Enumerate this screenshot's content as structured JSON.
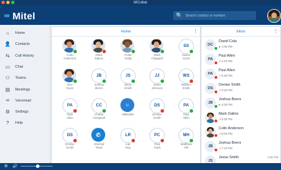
{
  "window": {
    "title": "MiCollab"
  },
  "colors": {
    "header": "#0b3f75",
    "accent": "#1b78c8",
    "present": "#27a844",
    "busy": "#d93b30",
    "away": "#f0a500"
  },
  "header": {
    "logo_text": "Mitel",
    "search": {
      "placeholder": "Search contact or number",
      "icon": "search-icon"
    }
  },
  "sidebar": {
    "items": [
      {
        "label": "Home",
        "icon": "home-icon",
        "glyph": "⌂"
      },
      {
        "label": "Contacts",
        "icon": "contacts-icon",
        "glyph": "👤"
      },
      {
        "label": "Call History",
        "icon": "call-history-icon",
        "glyph": "⇆"
      },
      {
        "label": "Chat",
        "icon": "chat-icon",
        "glyph": "▭"
      },
      {
        "label": "Teams",
        "icon": "teams-icon",
        "glyph": "⚇"
      },
      {
        "label": "Meetings",
        "icon": "meetings-icon",
        "glyph": "▤"
      },
      {
        "label": "Voicemail",
        "icon": "voicemail-icon",
        "glyph": "∞"
      },
      {
        "label": "Settings",
        "icon": "settings-icon",
        "glyph": "⚙"
      },
      {
        "label": "Help",
        "icon": "help-icon",
        "glyph": "?"
      }
    ]
  },
  "home": {
    "title": "Home",
    "more_icon": "more-icon",
    "tiles": [
      {
        "label": "Colin\nAnderson",
        "initials": "",
        "photo": true,
        "status": "present"
      },
      {
        "label": "Mark\nDalton",
        "initials": "",
        "photo": true,
        "status": "busy"
      },
      {
        "label": "Annie\nGatla",
        "initials": "",
        "photo": true,
        "status": "present"
      },
      {
        "label": "Mark\nChappell",
        "initials": "",
        "photo": true,
        "status": "present"
      },
      {
        "label": "Susan\nScott",
        "initials": "SS",
        "photo": false,
        "status": "present"
      },
      {
        "label": "Dev\nIssan",
        "initials": "",
        "photo": true,
        "status": "present"
      },
      {
        "label": "Joshua\nBeers",
        "initials": "JB",
        "photo": false,
        "status": "present"
      },
      {
        "label": "Steve\nSmith",
        "initials": "JS",
        "photo": false,
        "status": "present"
      },
      {
        "label": "Jesse\nJohnson",
        "initials": "JJ",
        "photo": false,
        "status": "present"
      },
      {
        "label": "William\nSmith",
        "initials": "WS",
        "photo": false,
        "status": "busy"
      },
      {
        "label": "Paul\nAllen",
        "initials": "PA",
        "photo": false,
        "status": "busy"
      },
      {
        "label": "Charlie\nCampbell",
        "initials": "CC",
        "photo": false,
        "status": "present"
      },
      {
        "label": "MiMobile",
        "initials": "☺",
        "photo": false,
        "status": "",
        "special": "group"
      },
      {
        "label": "Denise\nSmith",
        "initials": "DS",
        "photo": false,
        "status": "busy"
      },
      {
        "label": "Paul\nAllen",
        "initials": "PA",
        "photo": false,
        "status": "present"
      },
      {
        "label": "Denise\nSmith",
        "initials": "DS",
        "photo": false,
        "status": "busy"
      },
      {
        "label": "Internal\nTeam",
        "initials": "✆",
        "photo": false,
        "status": "",
        "special": "phone"
      },
      {
        "label": "Lue\nRay",
        "initials": "LR",
        "photo": false,
        "status": "busy"
      },
      {
        "label": "Paul\nClark",
        "initials": "PC",
        "photo": false,
        "status": "busy"
      },
      {
        "label": "Matthew\nHill",
        "initials": "MH",
        "photo": false,
        "status": "present"
      }
    ]
  },
  "inbox": {
    "title": "Inbox",
    "more_icon": "more-icon",
    "items": [
      {
        "initials": "DC",
        "name": "David Cola",
        "time": "1:00 PM",
        "status": "present",
        "photo": false
      },
      {
        "initials": "PA",
        "name": "Paul Allen",
        "time": "1:10 PM",
        "status": "busy",
        "photo": false
      },
      {
        "initials": "PA",
        "name": "Paul Allen",
        "time": "3:20 PM",
        "status": "busy",
        "photo": false
      },
      {
        "initials": "DS",
        "name": "Denise Smith",
        "time": "3:15 PM",
        "status": "busy",
        "photo": false
      },
      {
        "initials": "JB",
        "name": "Joshua Beers",
        "time": "4:00 PM",
        "status": "present",
        "photo": false
      },
      {
        "initials": "",
        "name": "Mark Dalton",
        "time": "5:30 PM",
        "status": "busy",
        "photo": true
      },
      {
        "initials": "",
        "name": "Colin Anderson",
        "time": "6:00 PM",
        "status": "busy",
        "photo": true
      },
      {
        "initials": "JB",
        "name": "Joshua Beers",
        "time": "7:10 PM",
        "status": "busy",
        "photo": false
      },
      {
        "initials": "JS",
        "name": "Jesse Smith",
        "time": "",
        "status": "",
        "photo": false,
        "right": "4:58 PM"
      }
    ]
  },
  "footer": {
    "icons": [
      "settings-icon",
      "volume-icon"
    ]
  }
}
